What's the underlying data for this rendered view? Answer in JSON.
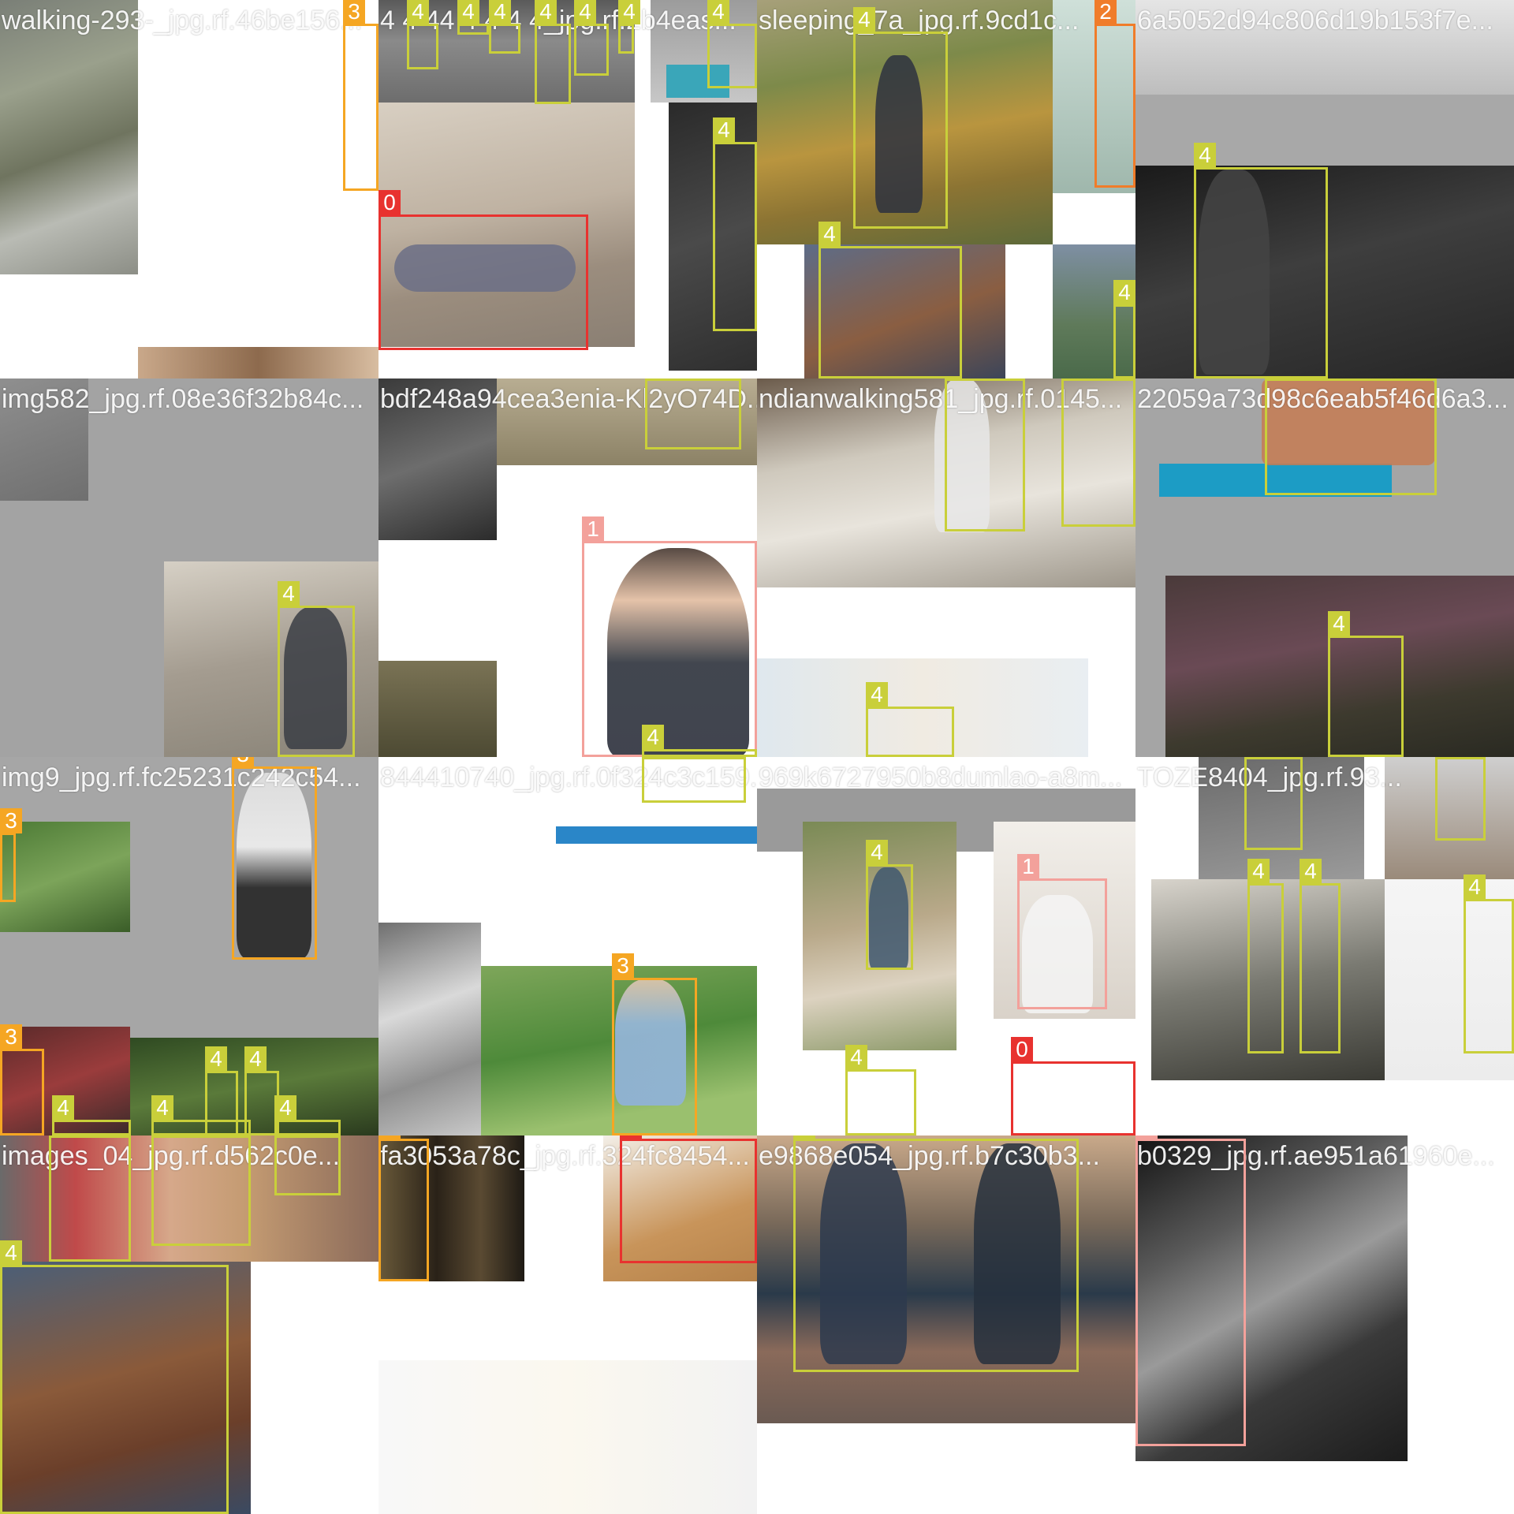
{
  "colors": {
    "class_0": "#e8322f",
    "class_1": "#f3a19b",
    "class_2": "#f07c2a",
    "class_3": "#f5a623",
    "class_4": "#c9cf3a"
  },
  "tiles": [
    {
      "title": "walking-293-_jpg.rf.46be156...",
      "boxes": [
        {
          "label": "3"
        }
      ]
    },
    {
      "title": "4 4 44 4 4 4 4_jpg.rf.2b4eas...",
      "boxes": [
        {
          "label": "4"
        },
        {
          "label": "4"
        },
        {
          "label": "4"
        },
        {
          "label": "4"
        },
        {
          "label": "4"
        },
        {
          "label": "4"
        },
        {
          "label": "0"
        },
        {
          "label": "4"
        },
        {
          "label": "4"
        }
      ]
    },
    {
      "title": "sleeping_7a_jpg.rf.9cd1c...",
      "boxes": [
        {
          "label": "4"
        },
        {
          "label": "2"
        },
        {
          "label": "4"
        },
        {
          "label": "4"
        }
      ]
    },
    {
      "title": "6a5052d94c806d19b153f7e...",
      "boxes": [
        {
          "label": "4"
        }
      ]
    },
    {
      "title": "img582_jpg.rf.08e36f32b84c...",
      "boxes": [
        {
          "label": "4"
        }
      ]
    },
    {
      "title": "bdf248a94cea3enia-Kl2yO74D...",
      "boxes": [
        {
          "label": "4"
        },
        {
          "label": "1"
        },
        {
          "label": "4"
        }
      ]
    },
    {
      "title": "ndianwalking581_jpg.rf.0145...",
      "boxes": [
        {
          "label": "4"
        },
        {
          "label": "4"
        },
        {
          "label": "4"
        }
      ]
    },
    {
      "title": "22059a73d98c6eab5f46d6a3...",
      "boxes": [
        {
          "label": "4"
        },
        {
          "label": "4"
        }
      ]
    },
    {
      "title": "img9_jpg.rf.fc25231c242c54...",
      "boxes": [
        {
          "label": "3"
        },
        {
          "label": "3"
        },
        {
          "label": "3"
        },
        {
          "label": "4"
        },
        {
          "label": "4"
        },
        {
          "label": "4"
        },
        {
          "label": "4"
        },
        {
          "label": "4"
        }
      ]
    },
    {
      "title": "844410740_jpg.rf.0f324c3c159...",
      "boxes": [
        {
          "label": "3"
        },
        {
          "label": "4"
        }
      ]
    },
    {
      "title": "969k6727950b8dumlao-a8m...",
      "boxes": [
        {
          "label": "4"
        },
        {
          "label": "1"
        },
        {
          "label": "4"
        },
        {
          "label": "0"
        }
      ]
    },
    {
      "title": "TOZE8404_jpg.rf.93...",
      "boxes": [
        {
          "label": "4"
        },
        {
          "label": "4"
        },
        {
          "label": "4"
        },
        {
          "label": "4"
        },
        {
          "label": "4"
        }
      ]
    },
    {
      "title": "images_04_jpg.rf.d562c0e...",
      "boxes": [
        {
          "label": "4"
        },
        {
          "label": "4"
        },
        {
          "label": "4"
        },
        {
          "label": "4"
        }
      ]
    },
    {
      "title": "fa3053a78c_jpg.rf.324fc8454...",
      "boxes": [
        {
          "label": "3"
        },
        {
          "label": "0"
        }
      ]
    },
    {
      "title": "e9868e054_jpg.rf.b7c30b3...",
      "boxes": [
        {
          "label": "4"
        }
      ]
    },
    {
      "title": "b0329_jpg.rf.ae951a61960e...",
      "boxes": [
        {
          "label": "1"
        }
      ]
    }
  ]
}
